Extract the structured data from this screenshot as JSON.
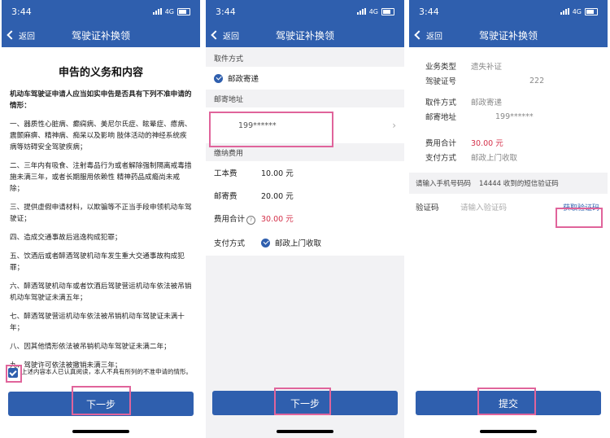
{
  "status": {
    "time": "3:44",
    "network": "4G"
  },
  "nav": {
    "back": "返回",
    "title": "驾驶证补换领"
  },
  "page1": {
    "heading": "申告的义务和内容",
    "lead": "机动车驾驶证申请人应当如实申告是否具有下列不准申请的情形：",
    "items": [
      "一、器质性心脏病、癫痫病、美尼尔氏症、眩晕症、癔病、震颤麻痹、精神病、痴呆以及影响 肢体活动的神经系统疾病等妨碍安全驾驶疾病；",
      "二、三年内有吸食、注射毒品行为或者解除强制隔离戒毒措施未满三年，或者长期服用依赖性 精神药品成瘾尚未戒除；",
      "三、提供虚假申请材料，以欺骗等不正当手段申领机动车驾驶证；",
      "四、造成交通事故后逃逸构成犯罪；",
      "五、饮酒后或者醉酒驾驶机动车发生重大交通事故构成犯罪；",
      "六、醉酒驾驶机动车或者饮酒后驾驶营运机动车依法被吊销机动车驾驶证未满五年；",
      "七、醉酒驾驶营运机动车依法被吊销机动车驾驶证未满十年；",
      "八、因其他情形依法被吊销机动车驾驶证未满二年；",
      "九、驾驶许可依法被撤销未满三年；"
    ],
    "agree_text": "上述内容本人已认真阅读，本人不具有所列的不准申请的情形。",
    "next_button": "下一步"
  },
  "page2": {
    "pickup_header": "取件方式",
    "pickup_option": "邮政寄递",
    "address_header": "邮寄地址",
    "address_value": "199******",
    "fee_header": "缴纳费用",
    "fees": [
      {
        "label": "工本费",
        "value": "10.00 元"
      },
      {
        "label": "邮寄费",
        "value": "20.00 元"
      }
    ],
    "total_label": "费用合计",
    "total_value": "30.00 元",
    "help_mark": "?",
    "pay_label": "支付方式",
    "pay_value": "邮政上门收取",
    "next_button": "下一步"
  },
  "page3": {
    "biz_type_label": "业务类型",
    "biz_type_value": "遗失补证",
    "license_label": "驾驶证号",
    "license_value": "222",
    "pickup_label": "取件方式",
    "pickup_value": "邮政寄递",
    "address_label": "邮寄地址",
    "address_value": "199******",
    "total_label": "费用合计",
    "total_value": "30.00 元",
    "pay_label": "支付方式",
    "pay_value": "邮政上门收取",
    "sms_prompt": "请输入手机号码码",
    "sms_suffix": "14444 收到的短信验证码",
    "code_label": "验证码",
    "code_placeholder": "请输入验证码",
    "get_code": "获取验证码",
    "submit_button": "提交"
  },
  "colors": {
    "primary": "#2f5fae",
    "highlight": "#e0649b",
    "price": "#d4314a"
  }
}
